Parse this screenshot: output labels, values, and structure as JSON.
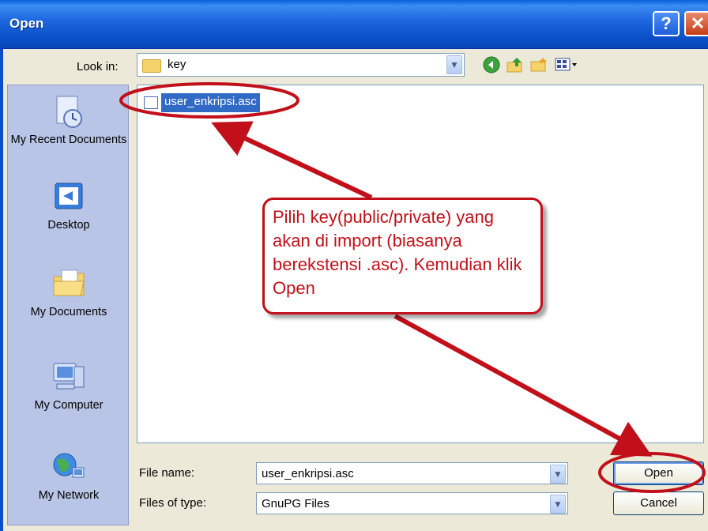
{
  "window": {
    "title": "Open",
    "help_icon": "?",
    "close_icon": "✕"
  },
  "toolbar": {
    "look_in_label": "Look in:",
    "look_in_value": "key",
    "icons": [
      "back-icon",
      "up-folder-icon",
      "new-folder-icon",
      "views-menu-icon"
    ]
  },
  "places": [
    {
      "label": "My Recent Documents",
      "icon": "recent-documents-icon"
    },
    {
      "label": "Desktop",
      "icon": "desktop-icon"
    },
    {
      "label": "My Documents",
      "icon": "my-documents-icon"
    },
    {
      "label": "My Computer",
      "icon": "my-computer-icon"
    },
    {
      "label": "My Network",
      "icon": "my-network-icon"
    }
  ],
  "files": [
    {
      "name": "user_enkripsi.asc",
      "selected": true
    }
  ],
  "form": {
    "file_name_label": "File name:",
    "file_name_value": "user_enkripsi.asc",
    "file_type_label": "Files of type:",
    "file_type_value": "GnuPG Files"
  },
  "buttons": {
    "open": "Open",
    "cancel": "Cancel"
  },
  "annotation": {
    "text": "Pilih key(public/private) yang akan di import (biasanya berekstensi .asc). Kemudian klik Open",
    "color": "#c2101a"
  }
}
